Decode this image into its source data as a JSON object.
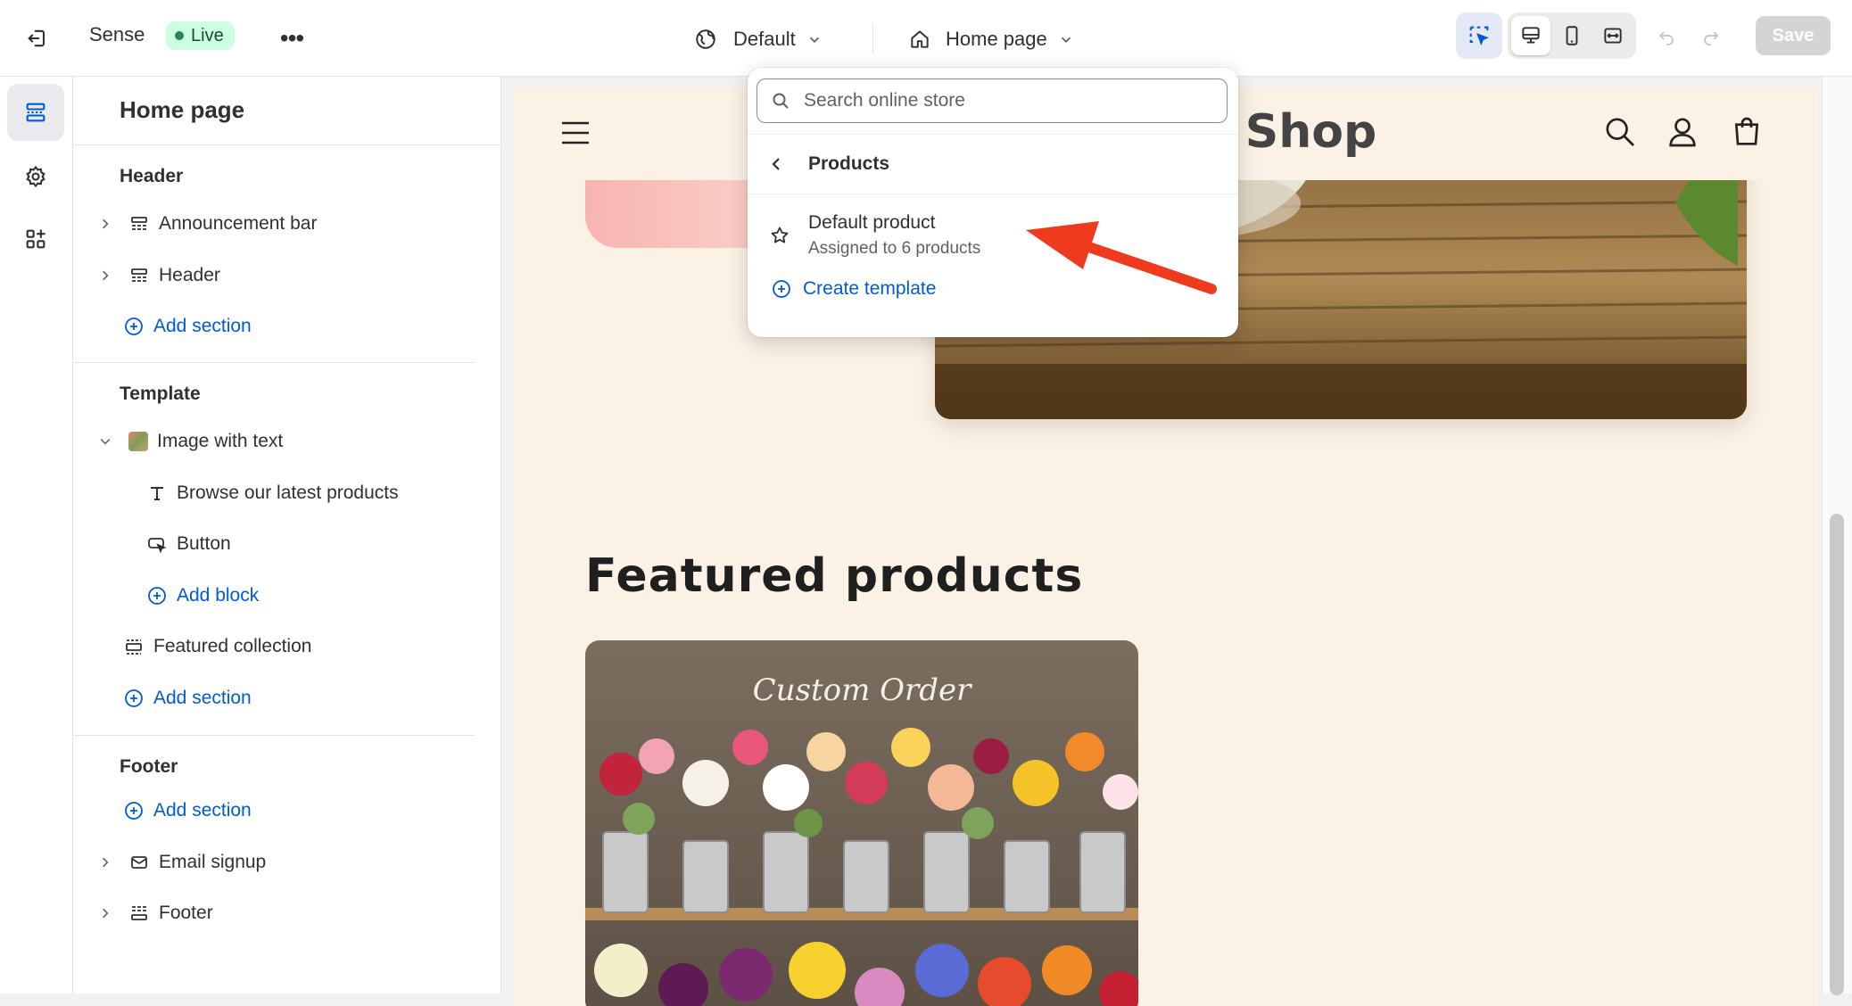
{
  "topbar": {
    "theme_name": "Sense",
    "live_label": "Live",
    "more_label": "•••",
    "locale_label": "Default",
    "page_label": "Home page",
    "save_label": "Save"
  },
  "sidebar": {
    "title": "Home page",
    "header_group": {
      "title": "Header",
      "items": [
        "Announcement bar",
        "Header"
      ],
      "add_label": "Add section"
    },
    "template_group": {
      "title": "Template",
      "section_label": "Image with text",
      "blocks": [
        "Browse our latest products",
        "Button"
      ],
      "add_block_label": "Add block",
      "collection_label": "Featured collection",
      "add_label": "Add section"
    },
    "footer_group": {
      "title": "Footer",
      "add_label": "Add section",
      "items": [
        "Email signup",
        "Footer"
      ]
    }
  },
  "dropdown": {
    "search_placeholder": "Search online store",
    "back_label": "Products",
    "item_title": "Default product",
    "item_subtitle": "Assigned to 6 products",
    "create_label": "Create template"
  },
  "preview": {
    "store_title_fragment": "r Shop",
    "featured_title": "Featured products",
    "product_caption": "Custom Order"
  },
  "colors": {
    "accent": "#005bd3",
    "live_bg": "#cdfee1",
    "preview_bg": "#fbf1e4",
    "arrow": "#f03a1e"
  }
}
